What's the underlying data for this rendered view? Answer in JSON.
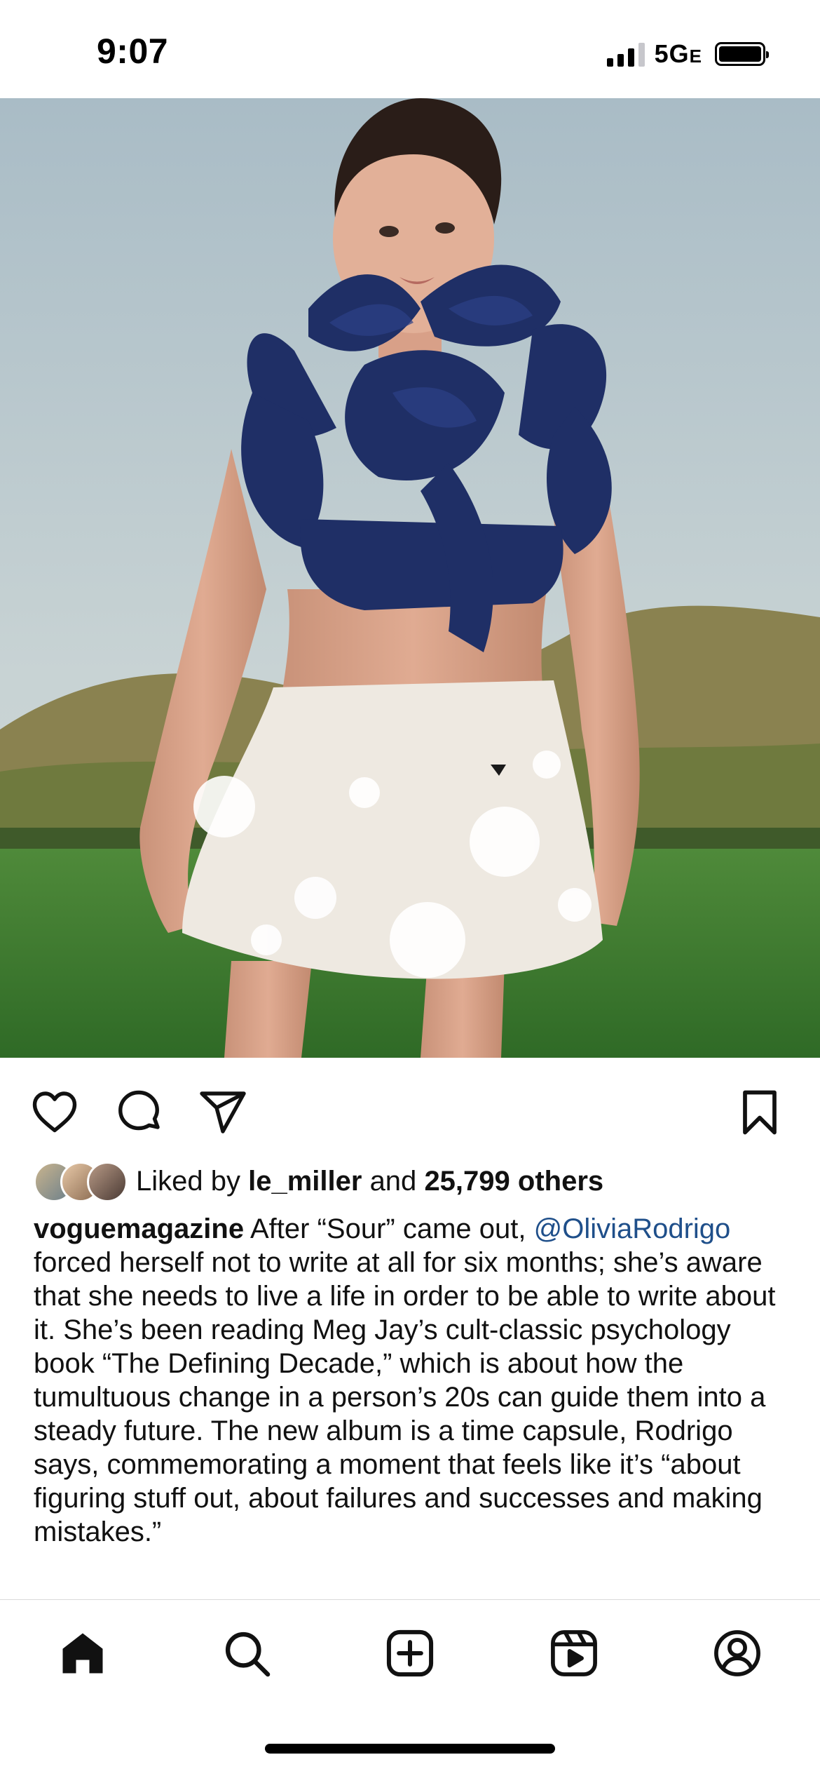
{
  "status": {
    "time": "9:07",
    "network": "5G",
    "network_suffix": "E",
    "signal_bars_active": 3,
    "signal_bars_total": 4,
    "battery_level": 1.0
  },
  "photo": {
    "description_icon": "post-photo"
  },
  "actions": {
    "like_icon": "heart-icon",
    "comment_icon": "comment-icon",
    "share_icon": "paper-plane-icon",
    "save_icon": "bookmark-icon"
  },
  "likes": {
    "prefix": "Liked by",
    "user": "le_miller",
    "joiner": "and",
    "others": "25,799 others"
  },
  "caption": {
    "username": "voguemagazine",
    "text_1": "After “Sour” came out,",
    "mention": "@OliviaRodrigo",
    "text_2": "forced herself not to write at all for six months; she’s aware that she needs to live a life in order to be able to write about it. She’s been reading Meg Jay’s cult-classic psychology book “The Defining Decade,” which is about how the tumultuous change in a person’s 20s can guide them into a steady future. The new album is a time capsule, Rodrigo says, commemorating a moment that feels like it’s “about figuring stuff out, about failures and successes and making mistakes.”"
  },
  "tabbar": {
    "items": [
      "home-icon",
      "search-icon",
      "create-icon",
      "reels-icon",
      "profile-icon"
    ]
  },
  "colors": {
    "mention": "#1f4f8a",
    "text": "#111111"
  }
}
